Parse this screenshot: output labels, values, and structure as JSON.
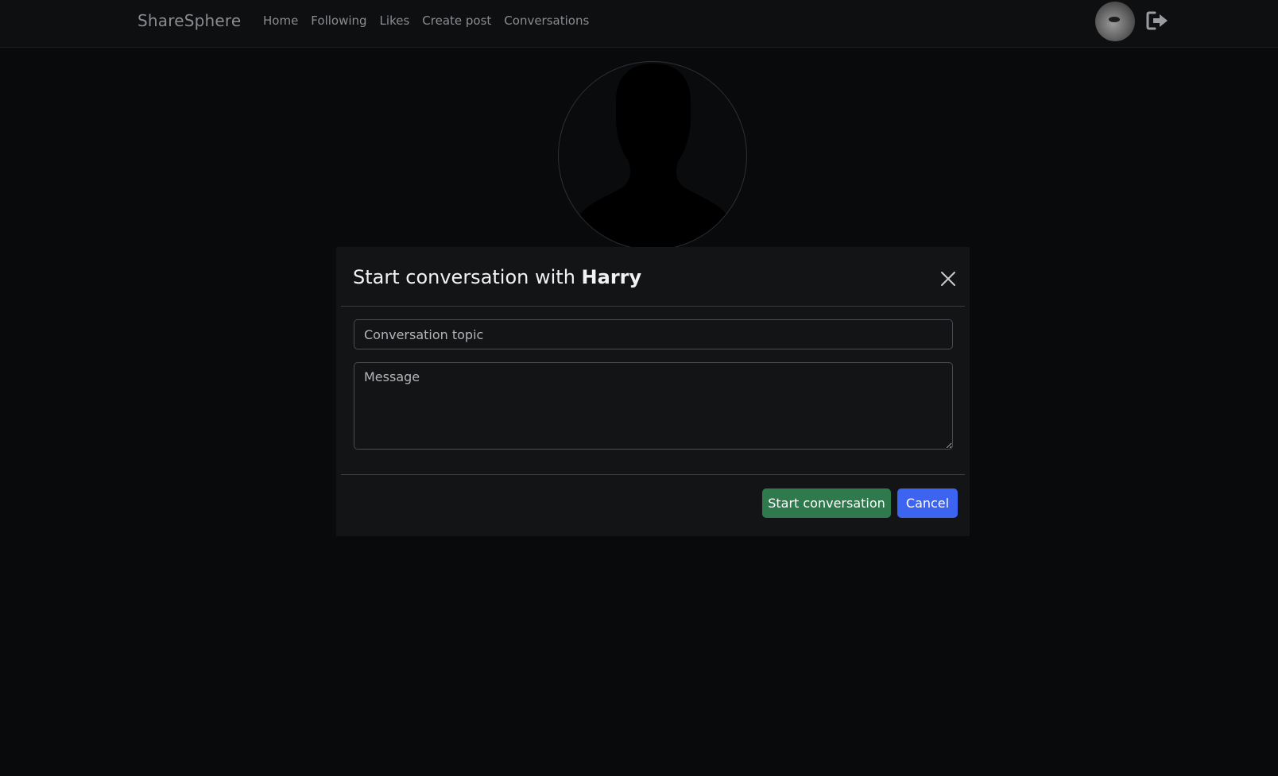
{
  "navbar": {
    "brand": "ShareSphere",
    "links": [
      "Home",
      "Following",
      "Likes",
      "Create post",
      "Conversations"
    ],
    "avatar_icon": "user-avatar",
    "logout_icon": "sign-out-icon"
  },
  "profile": {
    "picture_icon": "default-user-silhouette"
  },
  "modal": {
    "title_prefix": "Start conversation with ",
    "recipient": "Harry",
    "topic_placeholder": "Conversation topic",
    "topic_value": "",
    "message_placeholder": "Message",
    "message_value": "",
    "start_label": "Start conversation",
    "cancel_label": "Cancel"
  },
  "colors": {
    "background": "#090a0c",
    "navbar": "#0e0f11",
    "modal": "#131416",
    "start_button": "#2f7a4d",
    "cancel_button": "#3d63f1"
  }
}
